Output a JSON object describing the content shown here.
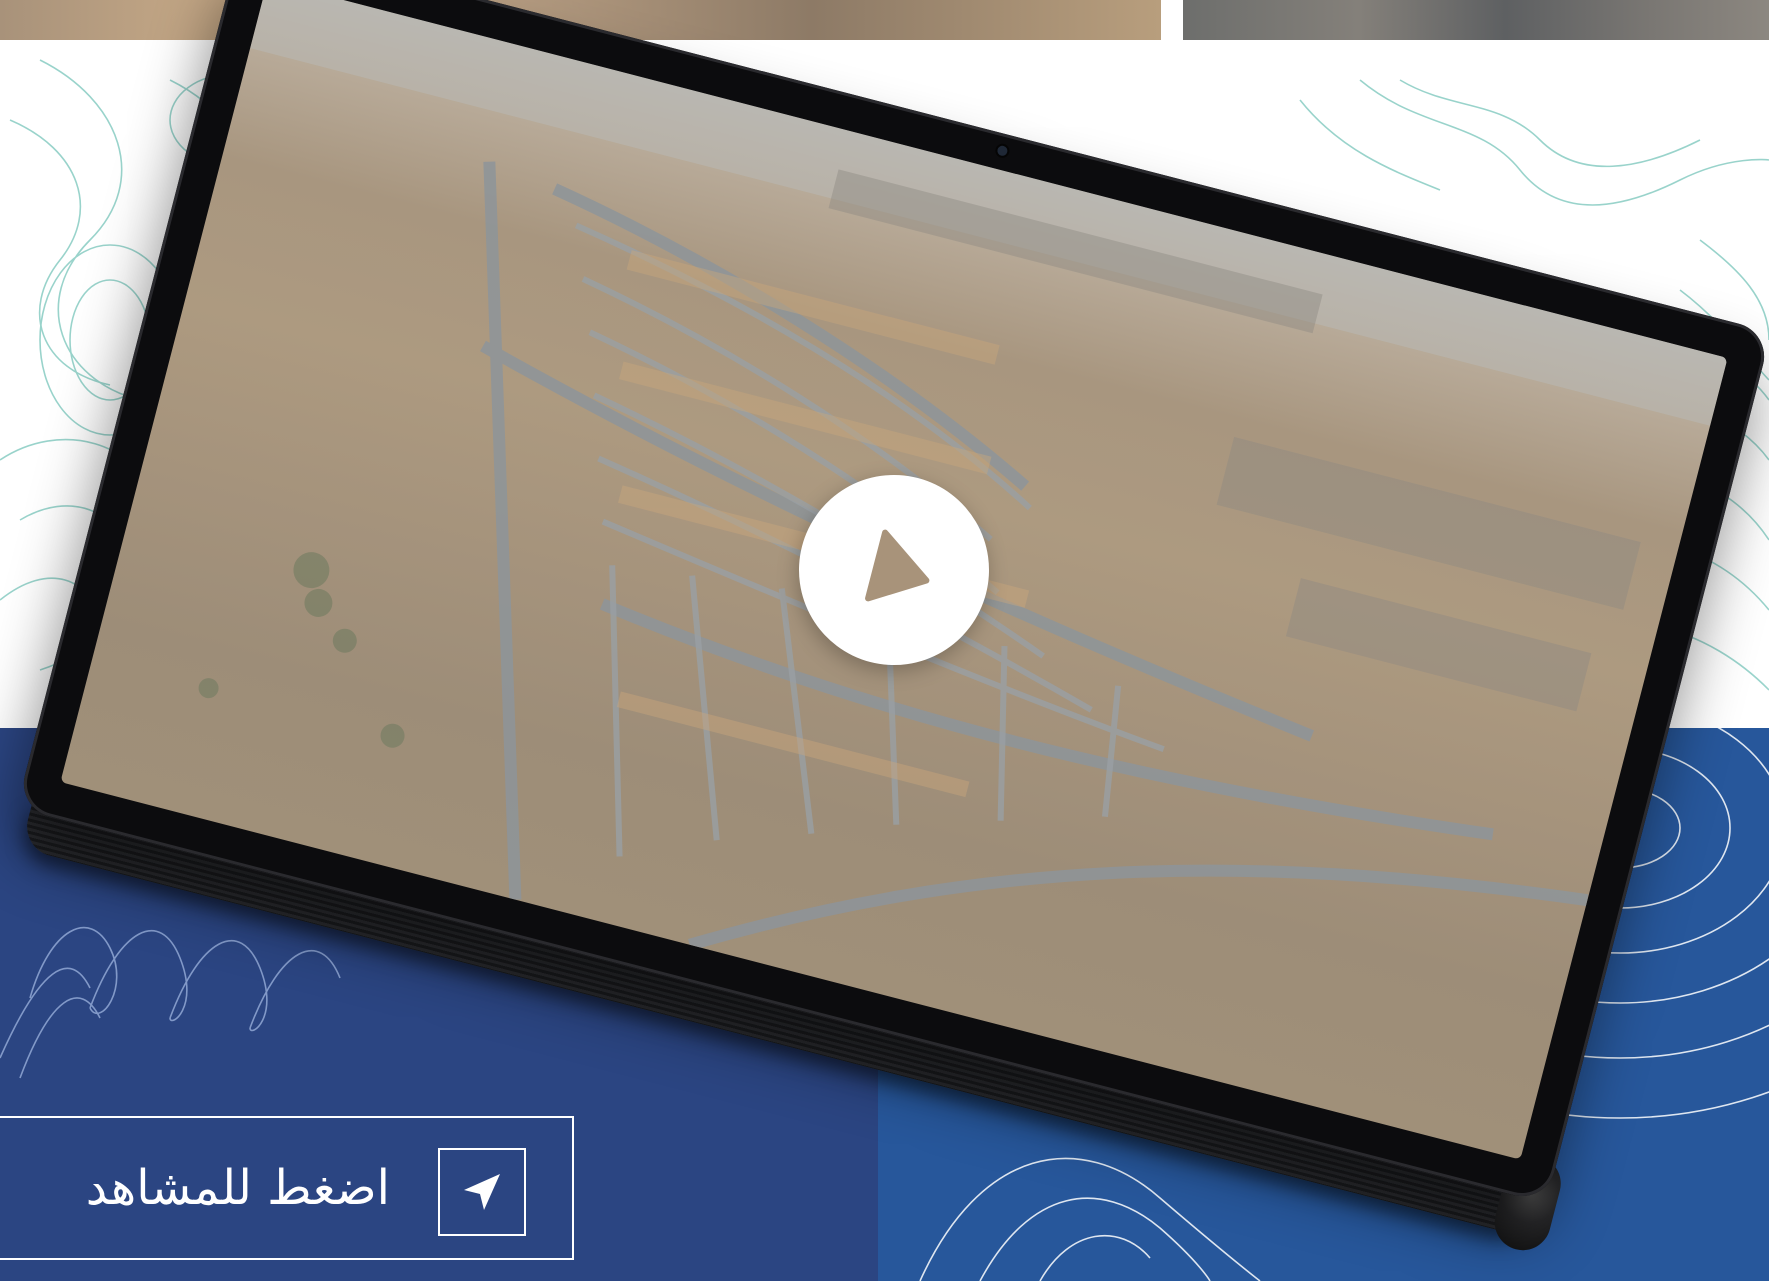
{
  "colors": {
    "blue_left": "#2b4582",
    "blue_right": "#27579b",
    "contour_light": "#8fcfc6",
    "contour_blue": "#9fb6e0",
    "white": "#ffffff",
    "tablet_frame": "#0c0c0e"
  },
  "video": {
    "play_icon": "play-icon",
    "play_color": "#a8937a"
  },
  "cta": {
    "label": "اضغط للمشاهد",
    "icon": "navigation-arrow-icon"
  }
}
